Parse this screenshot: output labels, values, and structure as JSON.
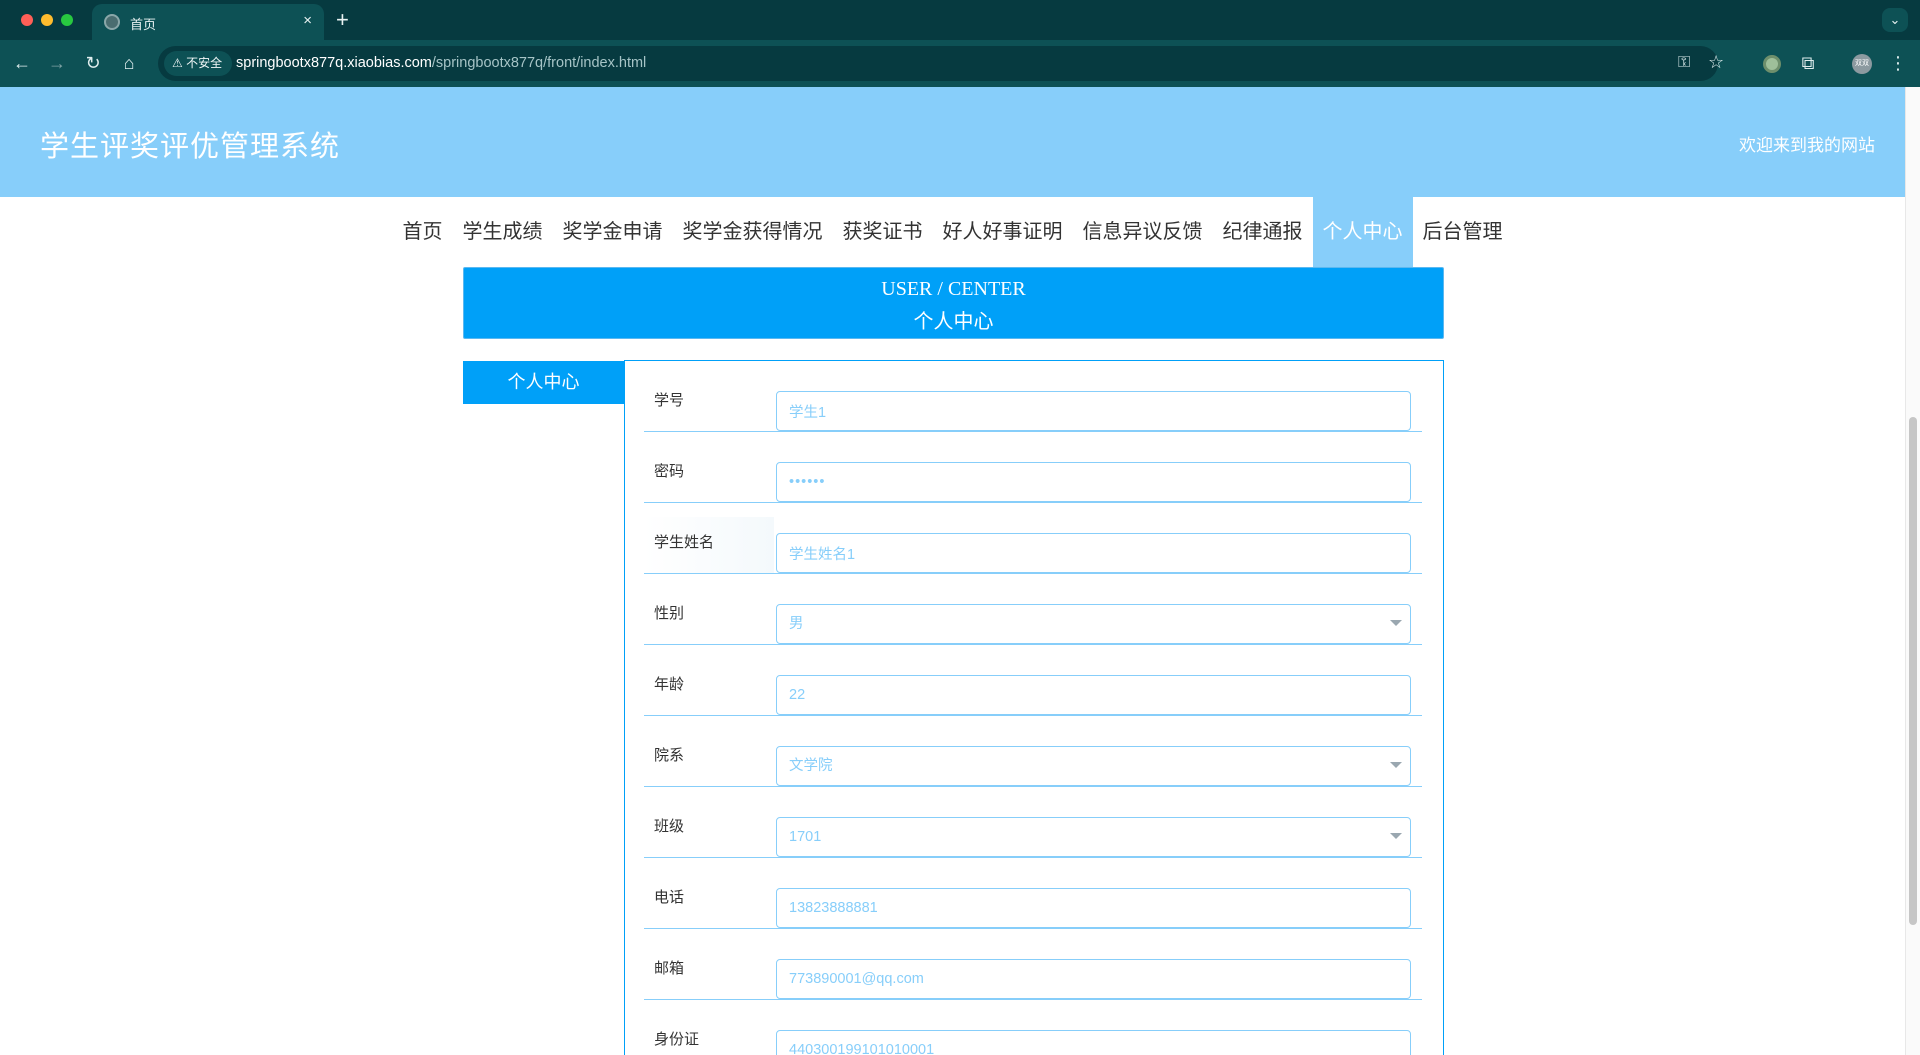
{
  "browser": {
    "tab_title": "首页",
    "tab_close": "×",
    "new_tab": "+",
    "tab_menu": "⌄",
    "back": "←",
    "forward": "→",
    "reload": "↻",
    "home": "⌂",
    "security_label": "不安全",
    "url_host": "springbootx877q.xiaobias.com",
    "url_path": "/springbootx877q/front/index.html",
    "key_icon": "⚿",
    "star_icon": "☆",
    "extensions_icon": "⧉",
    "profile_label": "双双",
    "menu_icon": "⋮"
  },
  "header": {
    "site_title": "学生评奖评优管理系统",
    "welcome": "欢迎来到我的网站"
  },
  "nav": {
    "items": [
      "首页",
      "学生成绩",
      "奖学金申请",
      "奖学金获得情况",
      "获奖证书",
      "好人好事证明",
      "信息异议反馈",
      "纪律通报",
      "个人中心",
      "后台管理"
    ],
    "active_index": 8
  },
  "banner": {
    "title_en": "USER / CENTER",
    "title_cn": "个人中心"
  },
  "side_menu": {
    "item": "个人中心"
  },
  "form": {
    "fields": [
      {
        "label": "学号",
        "value": "学生1",
        "type": "input"
      },
      {
        "label": "密码",
        "value": "••••••",
        "type": "password"
      },
      {
        "label": "学生姓名",
        "value": "学生姓名1",
        "type": "input"
      },
      {
        "label": "性别",
        "value": "男",
        "type": "select"
      },
      {
        "label": "年龄",
        "value": "22",
        "type": "input"
      },
      {
        "label": "院系",
        "value": "文学院",
        "type": "select"
      },
      {
        "label": "班级",
        "value": "1701",
        "type": "select"
      },
      {
        "label": "电话",
        "value": "13823888881",
        "type": "input"
      },
      {
        "label": "邮箱",
        "value": "773890001@qq.com",
        "type": "input"
      },
      {
        "label": "身份证",
        "value": "440300199101010001",
        "type": "input"
      }
    ]
  },
  "colors": {
    "accent": "#00a0f8",
    "header": "#87cefa",
    "chrome_dark": "#063a40",
    "chrome_light": "#0d5155"
  }
}
